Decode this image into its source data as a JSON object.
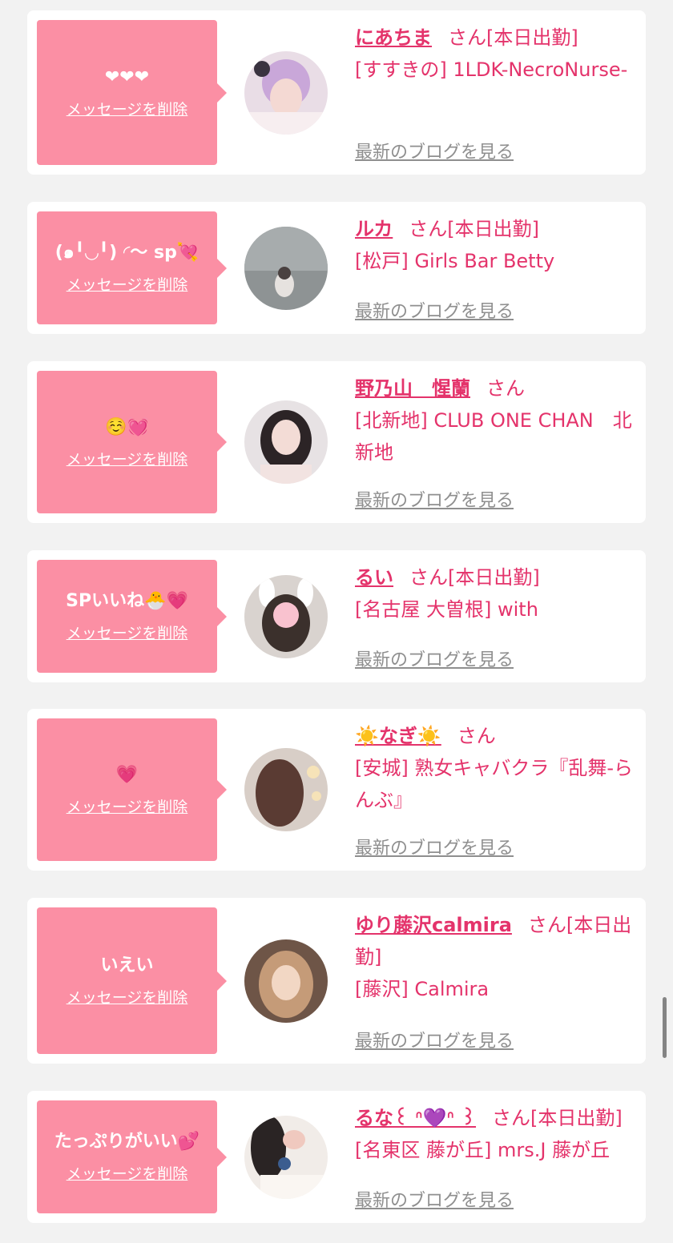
{
  "delete_label": "メッセージを削除",
  "blog_label": "最新のブログを見る",
  "san_label": "さん",
  "colors": {
    "accent": "#e4336b",
    "bubble": "#fb8fa4",
    "link_gray": "#8f8f8f",
    "background": "#f2f2f2"
  },
  "items": [
    {
      "message": "❤❤❤",
      "name": "にあちま",
      "status": "[本日出勤]",
      "shop": "[すすきの] 1LDK-NecroNurse-"
    },
    {
      "message": "(๑╹◡╹) ◜～ sp💘",
      "name": "ルカ",
      "status": "[本日出勤]",
      "shop": "[松戸] Girls Bar Betty"
    },
    {
      "message": "☺️💓",
      "name": "野乃山　惺蘭",
      "status": "",
      "shop": "[北新地] CLUB ONE CHAN　北新地"
    },
    {
      "message": "SPいいね🐣💗",
      "name": "るい",
      "status": "[本日出勤]",
      "shop": "[名古屋 大曽根] with"
    },
    {
      "message": "💗",
      "name": "☀️なぎ☀️",
      "status": "",
      "shop": "[安城] 熟女キャバクラ『乱舞-らんぶ』"
    },
    {
      "message": "いえい",
      "name": "ゆり藤沢calmira",
      "status": "[本日出勤]",
      "shop": "[藤沢] Calmira"
    },
    {
      "message": "たっぷりがいい💕",
      "name": "るな꒰ ᐢ💜ᐢ ꒱",
      "status": "[本日出勤]",
      "shop": "[名東区 藤が丘] mrs.J 藤が丘"
    }
  ]
}
